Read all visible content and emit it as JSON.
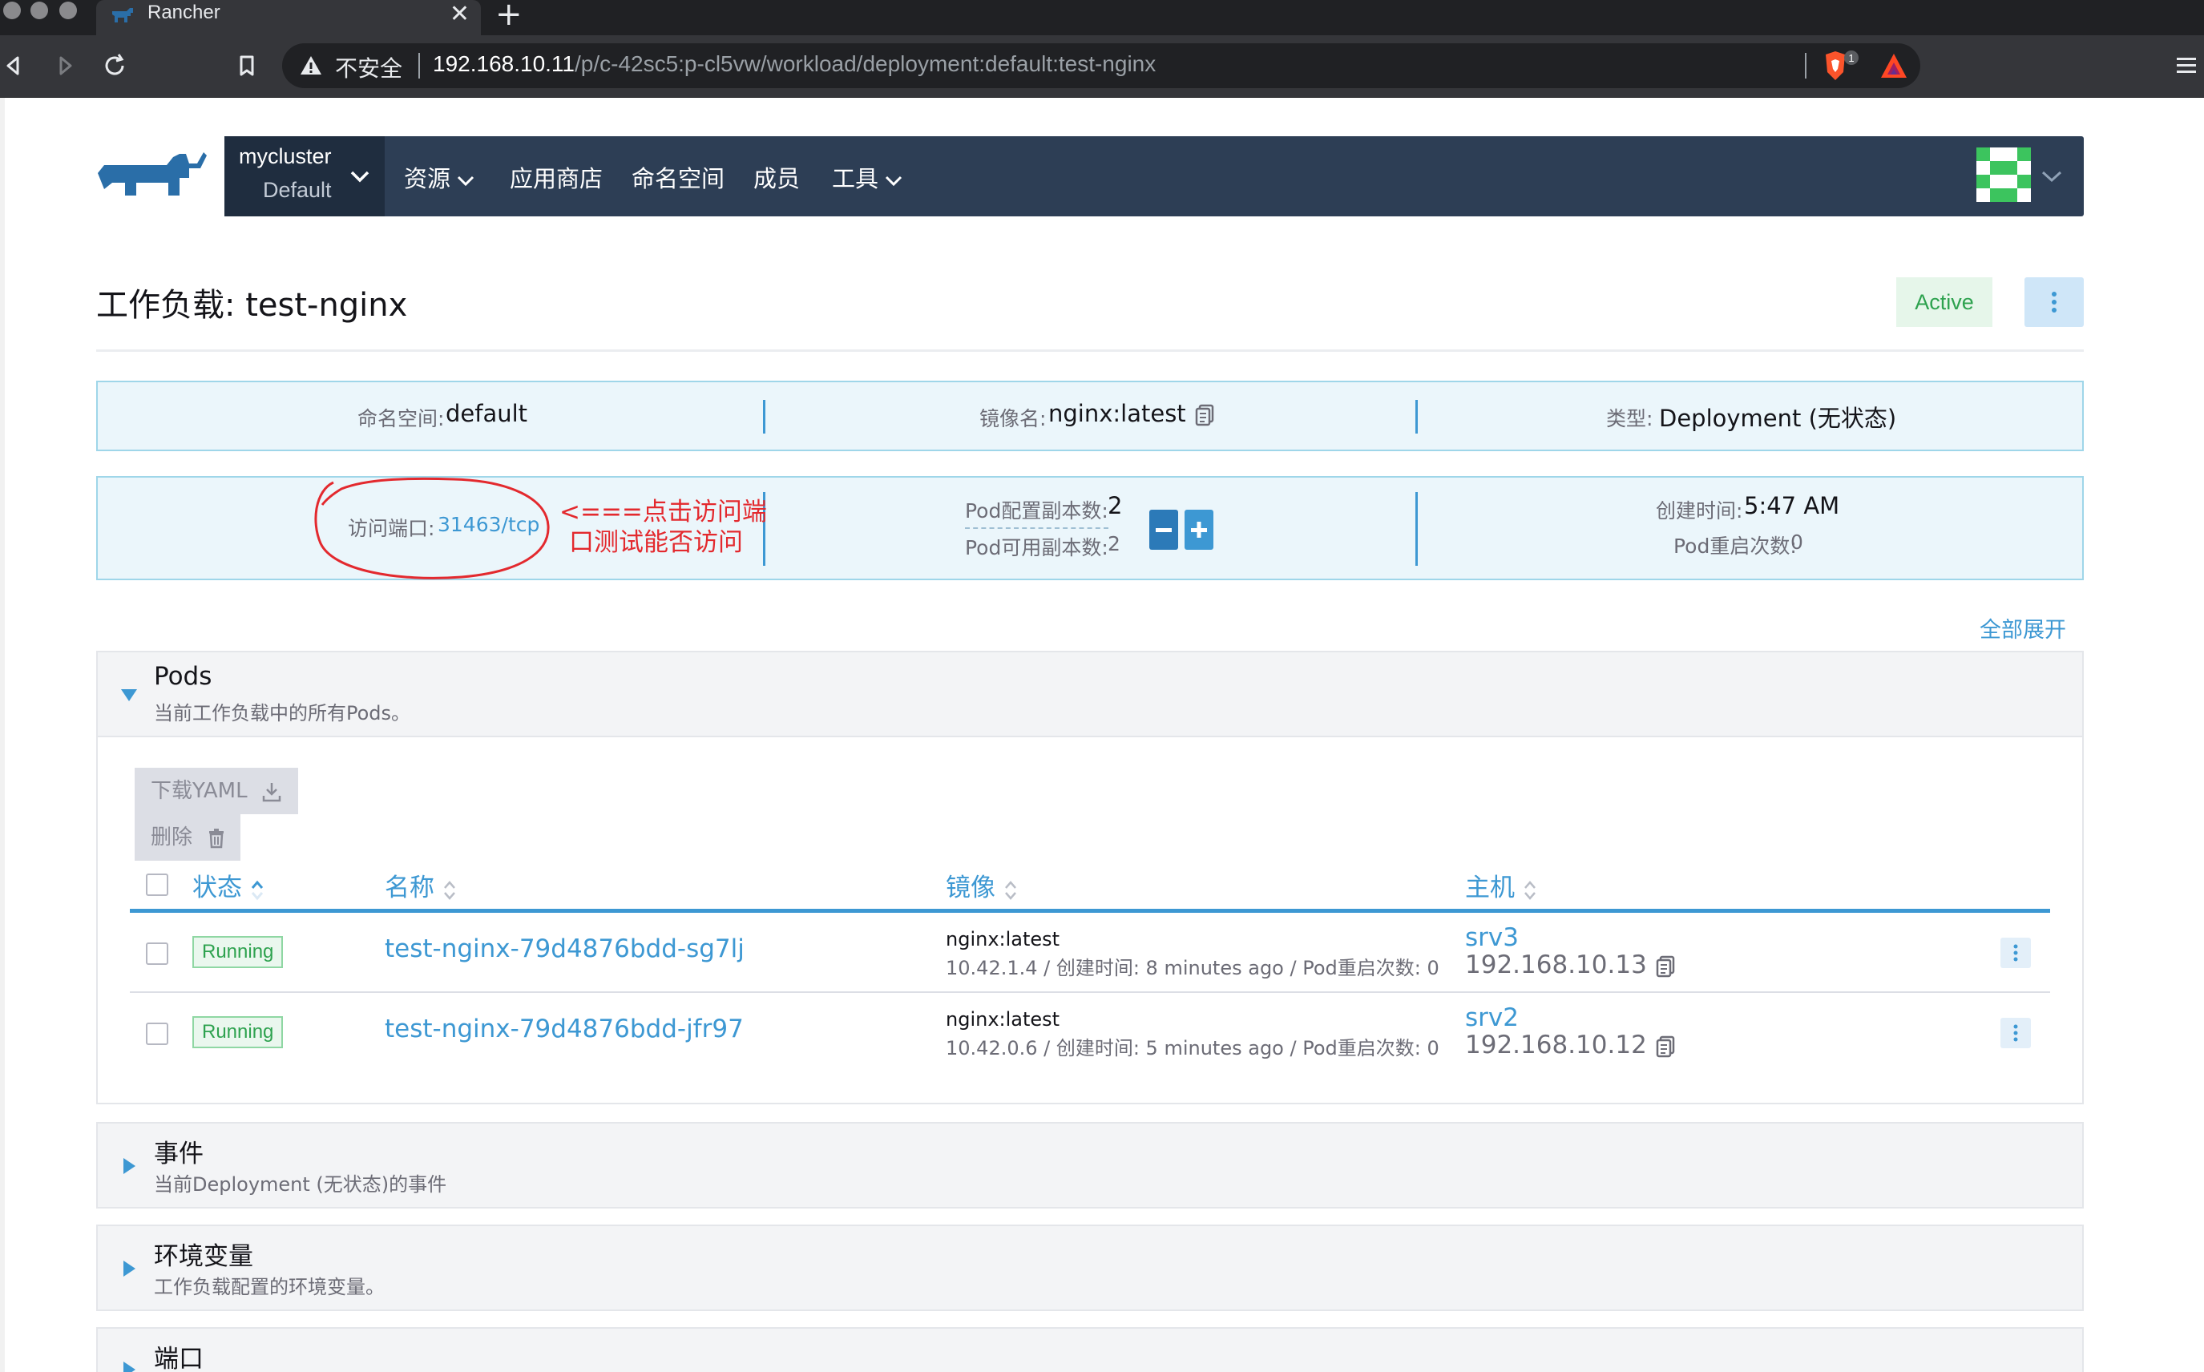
{
  "browser": {
    "tab_title": "Rancher",
    "tab_close": "✕",
    "tab_new": "+",
    "insecure_label": "不安全",
    "url_host": "192.168.10.11",
    "url_path": "/p/c-42sc5:p-cl5vw/workload/deployment:default:test-nginx",
    "brave_count": "1"
  },
  "nav": {
    "cluster_name": "mycluster",
    "project_name": "Default",
    "items": [
      {
        "label": "资源",
        "has_dropdown": true
      },
      {
        "label": "应用商店",
        "has_dropdown": false
      },
      {
        "label": "命名空间",
        "has_dropdown": false
      },
      {
        "label": "成员",
        "has_dropdown": false
      },
      {
        "label": "工具",
        "has_dropdown": true
      }
    ]
  },
  "page": {
    "title": "工作负载: test-nginx",
    "state": "Active",
    "expand_all": "全部展开"
  },
  "info": {
    "namespace_label": "命名空间:",
    "namespace_value": "default",
    "image_label": "镜像名:",
    "image_value": "nginx:latest",
    "type_label": "类型:",
    "type_value": "Deployment (无状态)",
    "endpoint_label": "访问端口:",
    "endpoint_value": "31463/tcp",
    "pod_config_label": "Pod配置副本数:",
    "pod_config_value": "2",
    "pod_avail_label": "Pod可用副本数:",
    "pod_avail_value": "2",
    "created_label": "创建时间:",
    "created_value": "5:47 AM",
    "restarts_label": "Pod重启次数:",
    "restarts_value": "0"
  },
  "annotation": {
    "line1": "<===点击访问端",
    "line2": "口测试能否访问",
    "color": "#e3292e"
  },
  "pods_section": {
    "title": "Pods",
    "subtitle": "当前工作负载中的所有Pods。",
    "download_yaml": "下载YAML",
    "delete": "删除",
    "columns": {
      "state": "状态",
      "name": "名称",
      "image": "镜像",
      "host": "主机"
    },
    "rows": [
      {
        "status": "Running",
        "name": "test-nginx-79d4876bdd-sg7lj",
        "image": "nginx:latest",
        "detail": "10.42.1.4 / 创建时间: 8 minutes ago / Pod重启次数: 0",
        "host": "srv3",
        "ip": "192.168.10.13"
      },
      {
        "status": "Running",
        "name": "test-nginx-79d4876bdd-jfr97",
        "image": "nginx:latest",
        "detail": "10.42.0.6 / 创建时间: 5 minutes ago / Pod重启次数: 0",
        "host": "srv2",
        "ip": "192.168.10.12"
      }
    ]
  },
  "sections": {
    "events_title": "事件",
    "events_subtitle": "当前Deployment (无状态)的事件",
    "env_title": "环境变量",
    "env_subtitle": "工作负载配置的环境变量。",
    "ports_title": "端口"
  },
  "colors": {
    "accent": "#3d98d3",
    "nav_bg": "#2d3e55",
    "banner_bg": "#ebf6fb",
    "active_green": "#2ea24f"
  }
}
